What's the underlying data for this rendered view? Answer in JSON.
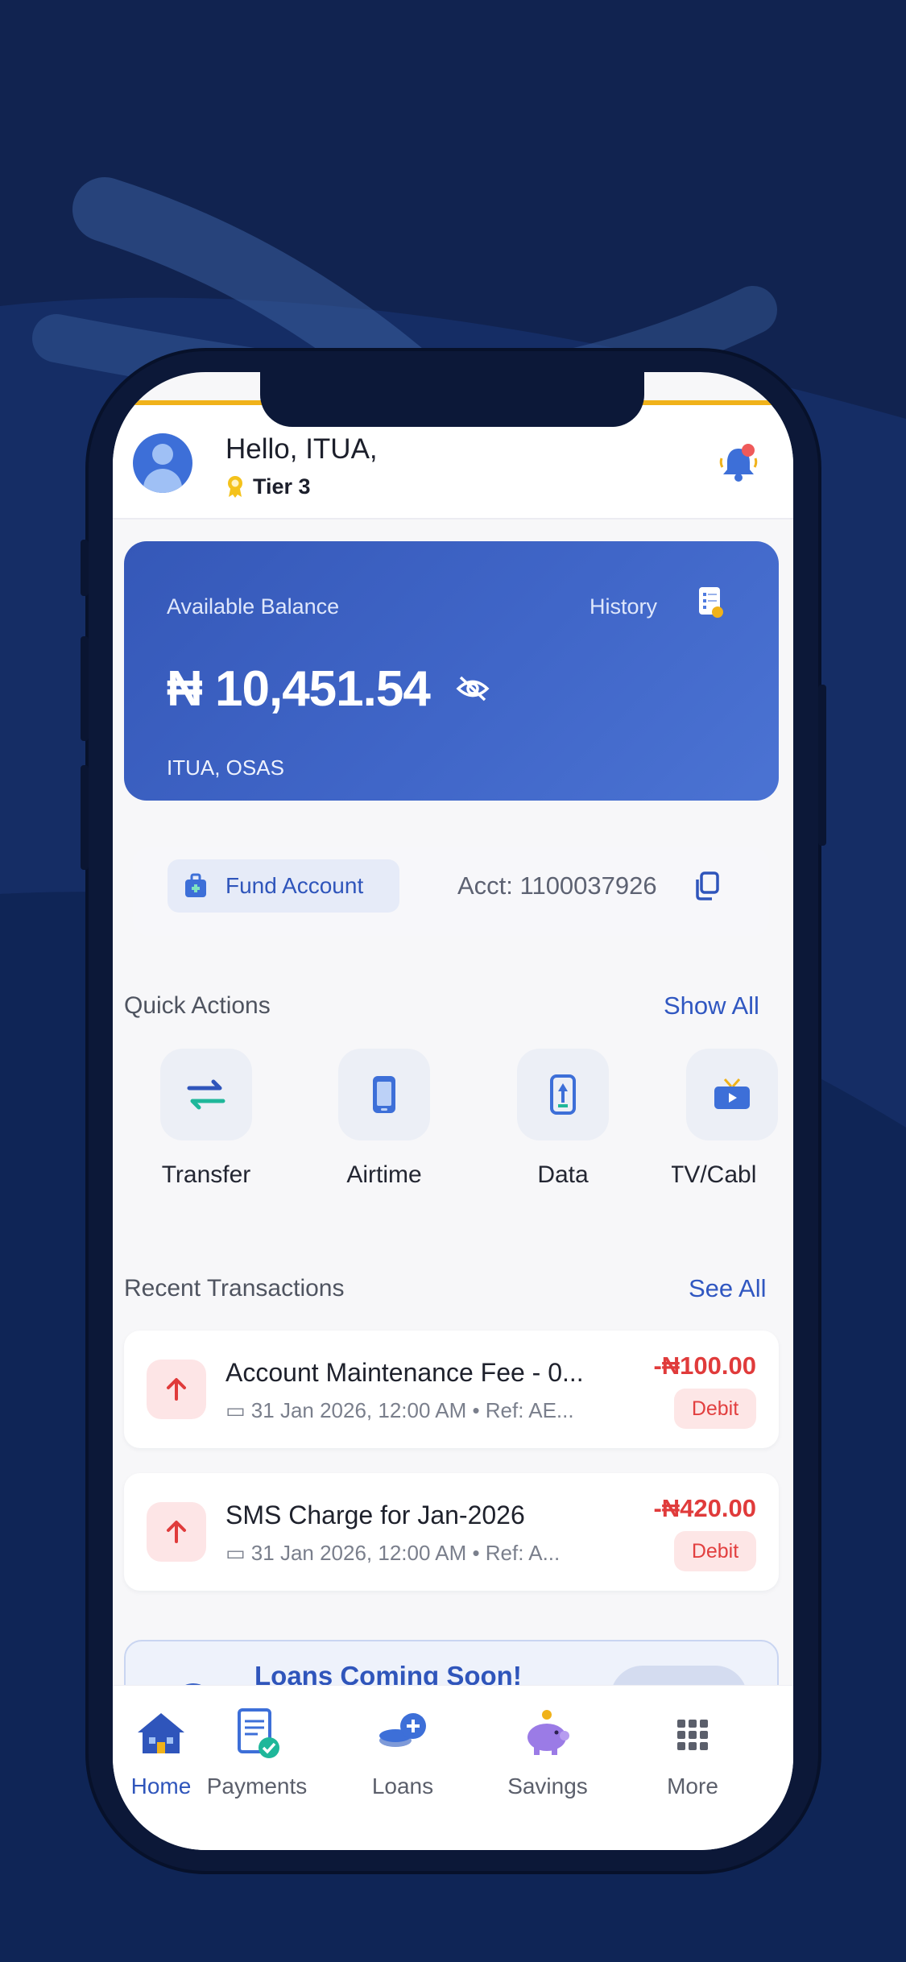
{
  "header": {
    "greeting": "Hello, ITUA,",
    "tier": "Tier 3"
  },
  "balance_card": {
    "label": "Available Balance",
    "history_label": "History",
    "amount": "₦ 10,451.54",
    "account_name": "ITUA, OSAS"
  },
  "fund_row": {
    "fund_label": "Fund Account",
    "account_number": "Acct: 1100037926"
  },
  "quick_actions": {
    "title": "Quick Actions",
    "show_all": "Show All",
    "items": [
      {
        "label": "Transfer",
        "icon": "transfer-icon"
      },
      {
        "label": "Airtime",
        "icon": "phone-icon"
      },
      {
        "label": "Data",
        "icon": "data-icon"
      },
      {
        "label": "TV/Cabl",
        "icon": "tv-icon"
      }
    ]
  },
  "recent_transactions": {
    "title": "Recent Transactions",
    "see_all": "See All",
    "items": [
      {
        "title": "Account Maintenance Fee - 0...",
        "meta": "31 Jan 2026, 12:00 AM • Ref: AE...",
        "amount": "-₦100.00",
        "type": "Debit"
      },
      {
        "title": "SMS Charge for Jan-2026",
        "meta": "31 Jan 2026, 12:00 AM • Ref: A...",
        "amount": "-₦420.00",
        "type": "Debit"
      }
    ]
  },
  "banner": {
    "title": "Loans Coming Soon!"
  },
  "bottom_nav": {
    "items": [
      {
        "label": "Home",
        "icon": "home-icon",
        "active": true
      },
      {
        "label": "Payments",
        "icon": "payments-icon",
        "active": false
      },
      {
        "label": "Loans",
        "icon": "loans-icon",
        "active": false
      },
      {
        "label": "Savings",
        "icon": "piggy-bank-icon",
        "active": false
      },
      {
        "label": "More",
        "icon": "grid-icon",
        "active": false
      }
    ]
  },
  "colors": {
    "background": "#112350",
    "accent": "#2f55bb",
    "card": "#4066c8",
    "debit": "#e03b3b",
    "tier_line": "#f0b21a"
  }
}
